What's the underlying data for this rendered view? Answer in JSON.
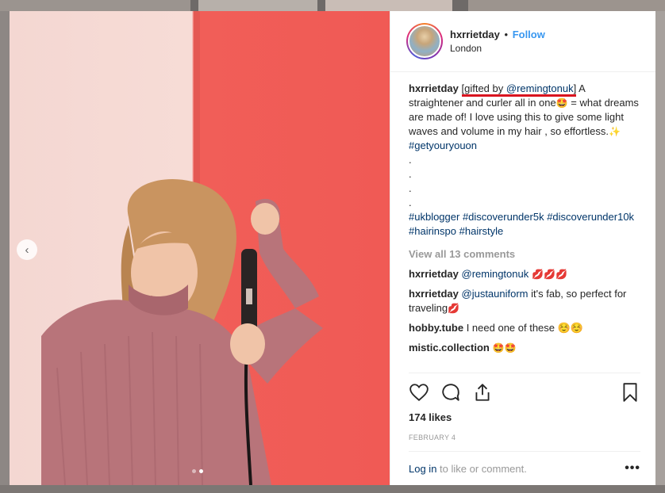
{
  "post": {
    "username": "hxrrietday",
    "follow_label": "Follow",
    "bullet": "•",
    "location": "London"
  },
  "caption": {
    "username": "hxrrietday",
    "gifted_open": "[gifted by ",
    "gifted_mention": "@remingtonuk",
    "gifted_close": "]",
    "line1": "A straightener and curler all in one",
    "line1_emoji": "🤩",
    "line1_rest": " = what dreams are made of! I love using this to give some light waves and volume in my hair , so effortless.",
    "sparkle_emoji": "✨",
    "hashtag1": "#getyouryouon",
    "dots": [
      ".",
      ".",
      ".",
      "."
    ],
    "hashtags": [
      "#ukblogger",
      "#discoverunder5k",
      "#discoverunder10k",
      "#hairinspo",
      "#hairstyle"
    ]
  },
  "view_all": "View all 13 comments",
  "comments": [
    {
      "user": "hxrrietday",
      "mention": "@remingtonuk",
      "text": "",
      "emoji": " 💋💋💋"
    },
    {
      "user": "hxrrietday",
      "mention": "@justauniform",
      "text": " it's fab, so perfect for traveling",
      "emoji": "💋"
    },
    {
      "user": "hobby.tube",
      "mention": "",
      "text": " I need one of these ☺️☺️",
      "emoji": ""
    },
    {
      "user": "mistic.collection",
      "mention": "",
      "text": " ",
      "emoji": "🤩🤩"
    }
  ],
  "likes": "174 likes",
  "date": "FEBRUARY 4",
  "footer": {
    "login": "Log in",
    "rest": " to like or comment.",
    "more": "•••"
  },
  "carousel": {
    "prev": "‹",
    "slides": 2,
    "active_slide": 2
  },
  "icons": [
    "heart-icon",
    "comment-icon",
    "share-icon",
    "bookmark-icon",
    "chevron-left-icon"
  ],
  "colors": {
    "accent": "#3897f0",
    "link": "#003569",
    "underline": "#d9141f",
    "wall": "#f05a55"
  }
}
